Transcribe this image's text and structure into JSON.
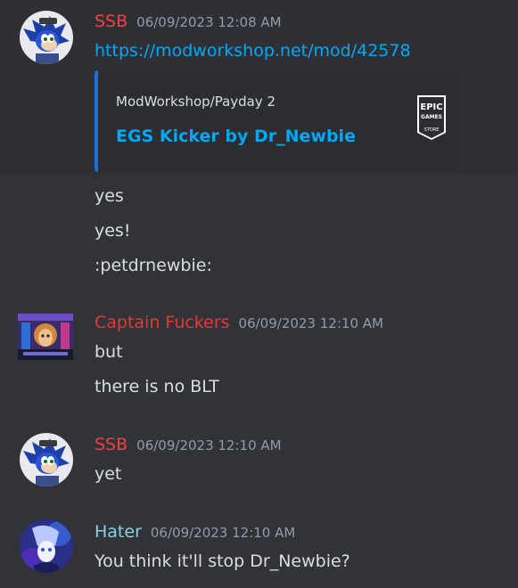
{
  "messages": [
    {
      "username": "SSB",
      "username_color": "#f23f43",
      "timestamp": "06/09/2023 12:08 AM",
      "link": "https://modworkshop.net/mod/42578",
      "embed": {
        "provider": "ModWorkshop/Payday 2",
        "title": "EGS Kicker by Dr_Newbie",
        "thumb_text": [
          "EPIC",
          "GAMES",
          "STORE"
        ]
      },
      "followups": [
        "yes",
        "yes!",
        ":petdrnewbie:"
      ]
    },
    {
      "username": "Captain Fuckers",
      "username_color": "#e53935",
      "timestamp": "06/09/2023 12:10 AM",
      "lines": [
        "but",
        "there is no BLT"
      ]
    },
    {
      "username": "SSB",
      "username_color": "#f23f43",
      "timestamp": "06/09/2023 12:10 AM",
      "lines": [
        "yet"
      ]
    },
    {
      "username": "Hater",
      "username_color": "#8fd0e0",
      "timestamp": "06/09/2023 12:10 AM",
      "lines": [
        "You think it'll stop Dr_Newbie?"
      ]
    }
  ],
  "colors": {
    "background": "#313338",
    "text": "#dbdee1",
    "muted": "#949ba4",
    "link": "#00a8fc",
    "embed_bar": "#1e70d8"
  }
}
